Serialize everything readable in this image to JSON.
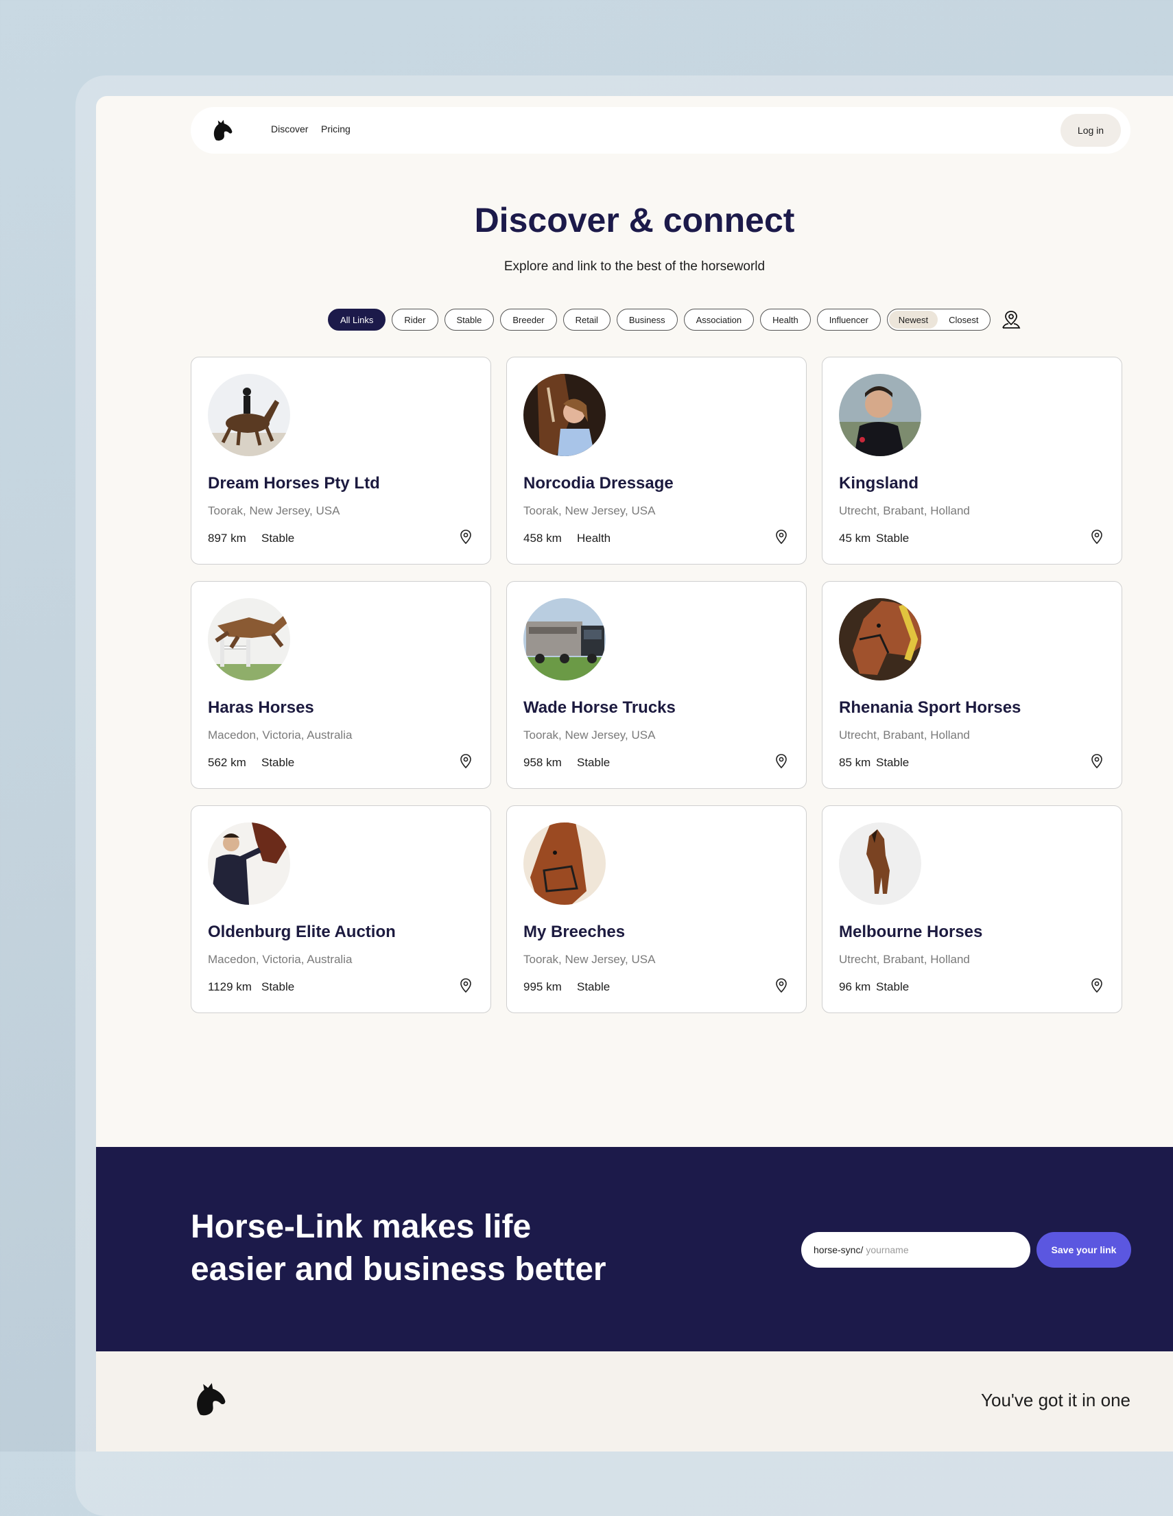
{
  "nav": {
    "links": [
      "Discover",
      "Pricing"
    ],
    "login_label": "Log in"
  },
  "hero": {
    "title": "Discover & connect",
    "subtitle": "Explore and link to the best of the horseworld"
  },
  "filters": {
    "categories": [
      "All Links",
      "Rider",
      "Stable",
      "Breeder",
      "Retail",
      "Business",
      "Association",
      "Health",
      "Influencer"
    ],
    "active_category": "All Links",
    "sort_options": [
      "Newest",
      "Closest"
    ],
    "active_sort": "Newest",
    "location_icon": "map-pin-person-icon"
  },
  "cards": [
    {
      "name": "Dream Horses Pty Ltd",
      "location": "Toorak, New Jersey, USA",
      "distance": "897 km",
      "category": "Stable",
      "avatar": "dressage-rider-photo"
    },
    {
      "name": "Norcodia Dressage",
      "location": "Toorak, New Jersey, USA",
      "distance": "458 km",
      "category": "Health",
      "avatar": "woman-with-horse-photo"
    },
    {
      "name": "Kingsland",
      "location": "Utrecht, Brabant, Holland",
      "distance": "45 km",
      "category": "Stable",
      "avatar": "man-portrait-photo"
    },
    {
      "name": "Haras Horses",
      "location": "Macedon, Victoria, Australia",
      "distance": "562 km",
      "category": "Stable",
      "avatar": "jumping-horse-photo"
    },
    {
      "name": "Wade Horse Trucks",
      "location": "Toorak, New Jersey, USA",
      "distance": "958 km",
      "category": "Stable",
      "avatar": "horse-truck-photo"
    },
    {
      "name": "Rhenania Sport Horses",
      "location": "Utrecht, Brabant, Holland",
      "distance": "85 km",
      "category": "Stable",
      "avatar": "horse-head-photo"
    },
    {
      "name": "Oldenburg Elite Auction",
      "location": "Macedon, Victoria, Australia",
      "distance": "1129 km",
      "category": "Stable",
      "avatar": "man-with-horse-photo"
    },
    {
      "name": "My Breeches",
      "location": "Toorak, New Jersey, USA",
      "distance": "995 km",
      "category": "Stable",
      "avatar": "chestnut-horse-photo"
    },
    {
      "name": "Melbourne Horses",
      "location": "Utrecht, Brabant, Holland",
      "distance": "96 km",
      "category": "Stable",
      "avatar": "standing-horse-photo"
    }
  ],
  "banner": {
    "title_line1": "Horse-Link makes life",
    "title_line2": "easier and business better",
    "link_prefix": "horse-sync/",
    "link_placeholder": "yourname",
    "save_label": "Save your link"
  },
  "footer": {
    "tagline": "You've got it in one"
  },
  "colors": {
    "brand_navy": "#1c1a4a",
    "accent_purple": "#5b57e0",
    "page_bg": "#faf8f4"
  }
}
